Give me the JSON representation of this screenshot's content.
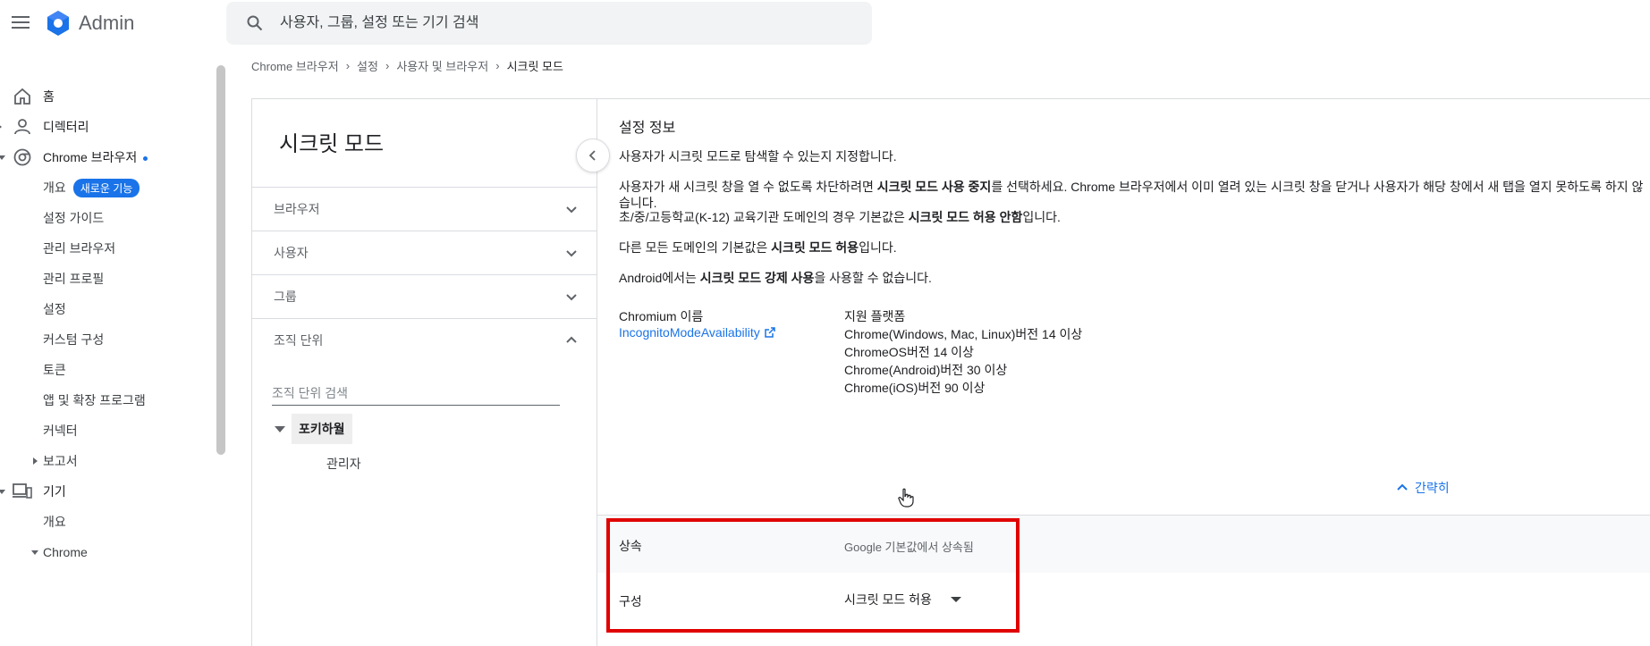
{
  "header": {
    "app_name": "Admin",
    "search_placeholder": "사용자, 그룹, 설정 또는 기기 검색"
  },
  "sidebar": {
    "home": "홈",
    "directory": "디렉터리",
    "chrome_browser": "Chrome 브라우저",
    "sub_items": {
      "overview": "개요",
      "new_feature_badge": "새로운 기능",
      "setup_guide": "설정 가이드",
      "managed_browsers": "관리 브라우저",
      "managed_profiles": "관리 프로필",
      "settings": "설정",
      "custom_config": "커스텀 구성",
      "tokens": "토큰",
      "apps_extensions": "앱 및 확장 프로그램",
      "connectors": "커넥터",
      "reports": "보고서"
    },
    "devices": "기기",
    "devices_overview": "개요",
    "chrome": "Chrome"
  },
  "breadcrumb": [
    "Chrome 브라우저",
    "설정",
    "사용자 및 브라우저",
    "시크릿 모드"
  ],
  "left_panel": {
    "title": "시크릿 모드",
    "sections": [
      "브라우저",
      "사용자",
      "그룹",
      "조직 단위"
    ],
    "org_search_placeholder": "조직 단위 검색",
    "org_root": "포키하월",
    "org_child": "관리자"
  },
  "info": {
    "title": "설정 정보",
    "p1": "사용자가 시크릿 모드로 탐색할 수 있는지 지정합니다.",
    "p2_a": "사용자가 새 시크릿 창을 열 수 없도록 차단하려면 ",
    "p2_b": "시크릿 모드 사용 중지",
    "p2_c": "를 선택하세요. Chrome 브라우저에서 이미 열려 있는 시크릿 창을 닫거나 사용자가 해당 창에서 새 탭을 열지 못하도록 하지 않습니다.",
    "p3_a": "초/중/고등학교(K-12) 교육기관 도메인의 경우 기본값은 ",
    "p3_b": "시크릿 모드 허용 안함",
    "p3_c": "입니다.",
    "p4_a": "다른 모든 도메인의 기본값은 ",
    "p4_b": "시크릿 모드 허용",
    "p4_c": "입니다.",
    "p5_a": "Android에서는 ",
    "p5_b": "시크릿 모드 강제 사용",
    "p5_c": "을 사용할 수 없습니다.",
    "chromium_name_label": "Chromium 이름",
    "chromium_link": "IncognitoModeAvailability",
    "platforms_label": "지원 플랫폼",
    "platforms": [
      "Chrome(Windows, Mac, Linux)버전 14 이상",
      "ChromeOS버전 14 이상",
      "Chrome(Android)버전 30 이상",
      "Chrome(iOS)버전 90 이상"
    ],
    "less_label": "간략히"
  },
  "settings_rows": {
    "inherit_label": "상속",
    "inherit_value": "Google 기본값에서 상속됨",
    "config_label": "구성",
    "config_value": "시크릿 모드 허용"
  },
  "colors": {
    "accent": "#1a73e8",
    "highlight": "#e00000"
  }
}
